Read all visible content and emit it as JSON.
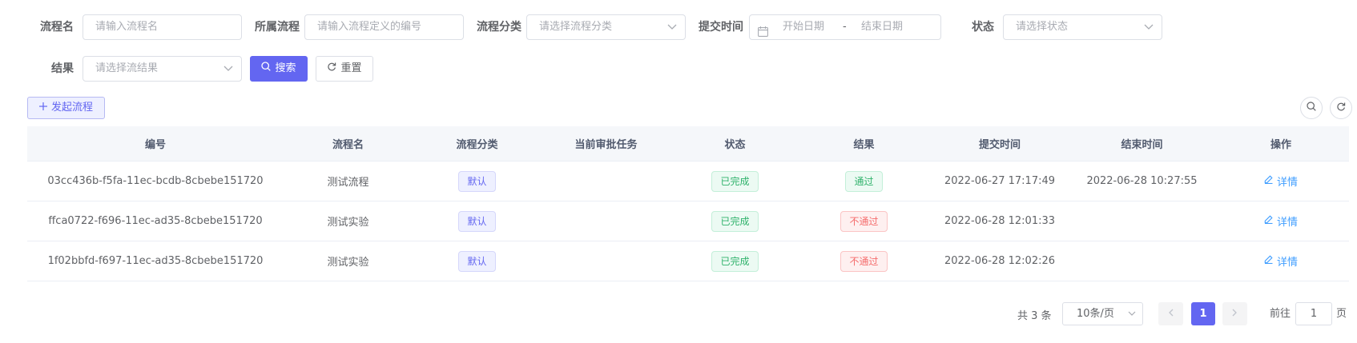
{
  "search": {
    "process_name": {
      "label": "流程名",
      "placeholder": "请输入流程名"
    },
    "belong_process": {
      "label": "所属流程",
      "placeholder": "请输入流程定义的编号"
    },
    "category": {
      "label": "流程分类",
      "placeholder": "请选择流程分类"
    },
    "submit_time": {
      "label": "提交时间",
      "start_placeholder": "开始日期",
      "separator": "-",
      "end_placeholder": "结束日期"
    },
    "status": {
      "label": "状态",
      "placeholder": "请选择状态"
    },
    "result": {
      "label": "结果",
      "placeholder": "请选择流结果"
    },
    "search_button": "搜索",
    "reset_button": "重置"
  },
  "toolbar": {
    "start_process_button": "发起流程"
  },
  "table": {
    "headers": [
      "编号",
      "流程名",
      "流程分类",
      "当前审批任务",
      "状态",
      "结果",
      "提交时间",
      "结束时间",
      "操作"
    ],
    "rows": [
      {
        "id": "03cc436b-f5fa-11ec-bcdb-8cbebe151720",
        "name": "测试流程",
        "category": "默认",
        "current_task": "",
        "status": "已完成",
        "result": "通过",
        "result_type": "success",
        "submit_time": "2022-06-27 17:17:49",
        "end_time": "2022-06-28 10:27:55",
        "action": "详情"
      },
      {
        "id": "ffca0722-f696-11ec-ad35-8cbebe151720",
        "name": "测试实验",
        "category": "默认",
        "current_task": "",
        "status": "已完成",
        "result": "不通过",
        "result_type": "danger",
        "submit_time": "2022-06-28 12:01:33",
        "end_time": "",
        "action": "详情"
      },
      {
        "id": "1f02bbfd-f697-11ec-ad35-8cbebe151720",
        "name": "测试实验",
        "category": "默认",
        "current_task": "",
        "status": "已完成",
        "result": "不通过",
        "result_type": "danger",
        "submit_time": "2022-06-28 12:02:26",
        "end_time": "",
        "action": "详情"
      }
    ]
  },
  "pagination": {
    "total": "共 3 条",
    "page_size": "10条/页",
    "current_page": "1",
    "goto_label": "前往",
    "goto_value": "1",
    "goto_unit": "页"
  },
  "colors": {
    "primary": "#6366f1",
    "success": "#2fb26b",
    "danger": "#f56c6c",
    "link": "#409eff"
  },
  "icons": {
    "search": "search-icon",
    "reset": "refresh-icon",
    "add": "plus-icon",
    "calendar": "calendar-icon",
    "chevron": "chevron-down-icon",
    "edit": "edit-icon",
    "prev": "chevron-left-icon",
    "next": "chevron-right-icon"
  }
}
